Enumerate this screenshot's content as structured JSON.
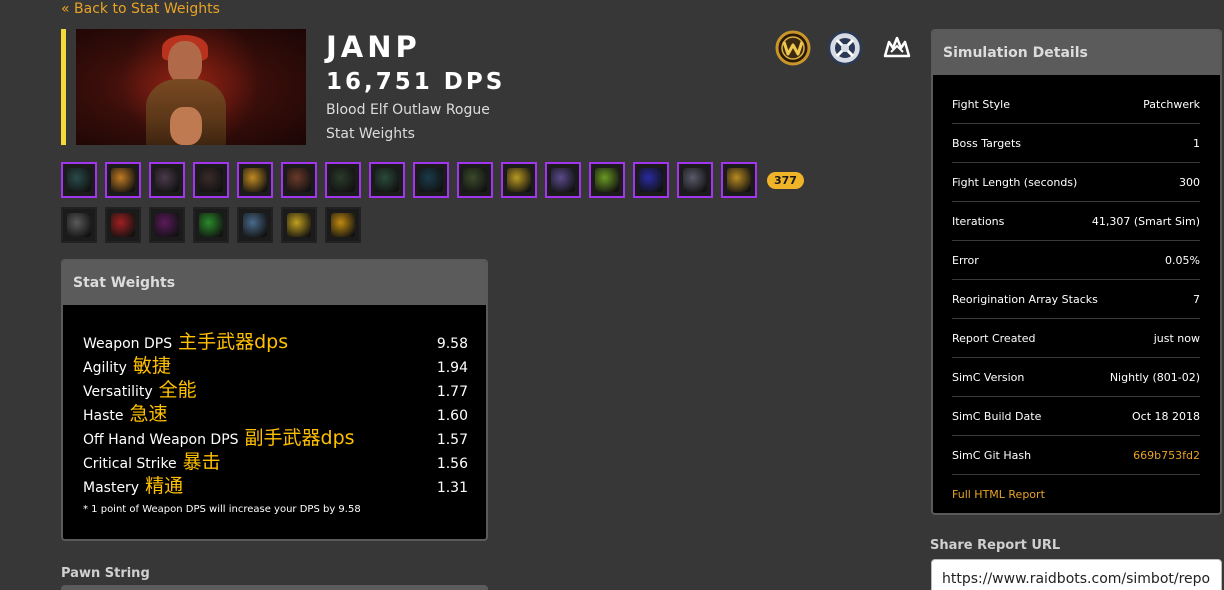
{
  "back_link": "« Back to Stat Weights",
  "character": {
    "name": "JANP",
    "dps": "16,751 DPS",
    "description": "Blood Elf Outlaw Rogue",
    "report_type": "Stat Weights"
  },
  "top_icons": [
    "wow-logo-icon",
    "alliance-crest-icon",
    "outlaw-spec-icon"
  ],
  "gear": {
    "row1": [
      {
        "icon": "helm-icon",
        "color": "#2a4a4a"
      },
      {
        "icon": "amulet-icon",
        "color": "#c07a22"
      },
      {
        "icon": "shoulders-icon",
        "color": "#4a3a4a"
      },
      {
        "icon": "chest-icon",
        "color": "#3a2a2a"
      },
      {
        "icon": "shield-ring-icon",
        "color": "#c08a22"
      },
      {
        "icon": "cloak-icon",
        "color": "#6a3a2a"
      },
      {
        "icon": "gloves-icon",
        "color": "#2a3a2a"
      },
      {
        "icon": "belt-icon",
        "color": "#2a4a3a"
      },
      {
        "icon": "legs-icon",
        "color": "#1a3a4a"
      },
      {
        "icon": "boots-icon",
        "color": "#3a4a2a"
      },
      {
        "icon": "ring-icon",
        "color": "#b89a22"
      },
      {
        "icon": "ring2-icon",
        "color": "#5a4a8a"
      },
      {
        "icon": "trinket-icon",
        "color": "#6a9a22"
      },
      {
        "icon": "trinket2-icon",
        "color": "#2a2aa0"
      },
      {
        "icon": "weapon-icon",
        "color": "#5a5a6a"
      },
      {
        "icon": "offhand-icon",
        "color": "#b88a22"
      }
    ],
    "row2": [
      {
        "icon": "traitdagger-icon",
        "color": "#5a5a5a"
      },
      {
        "icon": "trait2-icon",
        "color": "#a02020"
      },
      {
        "icon": "trait3-icon",
        "color": "#5a1a5a"
      },
      {
        "icon": "trait4-icon",
        "color": "#2a8a2a"
      },
      {
        "icon": "trait5-icon",
        "color": "#4a6a8a"
      },
      {
        "icon": "trait6-icon",
        "color": "#c0a020"
      },
      {
        "icon": "trait7-icon",
        "color": "#c08a10"
      }
    ],
    "item_level": "377"
  },
  "stat_weights": {
    "title": "Stat Weights",
    "rows": [
      {
        "label": "Weapon DPS",
        "note": "主手武器dps",
        "value": "9.58"
      },
      {
        "label": "Agility",
        "note": "敏捷",
        "value": "1.94"
      },
      {
        "label": "Versatility",
        "note": "全能",
        "value": "1.77"
      },
      {
        "label": "Haste",
        "note": "急速",
        "value": "1.60"
      },
      {
        "label": "Off Hand Weapon DPS",
        "note": "副手武器dps",
        "value": "1.57"
      },
      {
        "label": "Critical Strike",
        "note": "暴击",
        "value": "1.56"
      },
      {
        "label": "Mastery",
        "note": "精通",
        "value": "1.31"
      }
    ],
    "footnote": "* 1 point of Weapon DPS will increase your DPS by 9.58"
  },
  "simulation": {
    "title": "Simulation Details",
    "rows": [
      {
        "key": "Fight Style",
        "value": "Patchwerk"
      },
      {
        "key": "Boss Targets",
        "value": "1"
      },
      {
        "key": "Fight Length (seconds)",
        "value": "300"
      },
      {
        "key": "Iterations",
        "value": "41,307 (Smart Sim)"
      },
      {
        "key": "Error",
        "value": "0.05%"
      },
      {
        "key": "Reorigination Array Stacks",
        "value": "7"
      },
      {
        "key": "Report Created",
        "value": "just now"
      },
      {
        "key": "SimC Version",
        "value": "Nightly (801-02)"
      },
      {
        "key": "SimC Build Date",
        "value": "Oct 18 2018"
      },
      {
        "key": "SimC Git Hash",
        "value": "669b753fd2"
      }
    ],
    "full_report_link": "Full HTML Report"
  },
  "share": {
    "label": "Share Report URL",
    "url": "https://www.raidbots.com/simbot/repo"
  },
  "pawn": {
    "label": "Pawn String"
  }
}
